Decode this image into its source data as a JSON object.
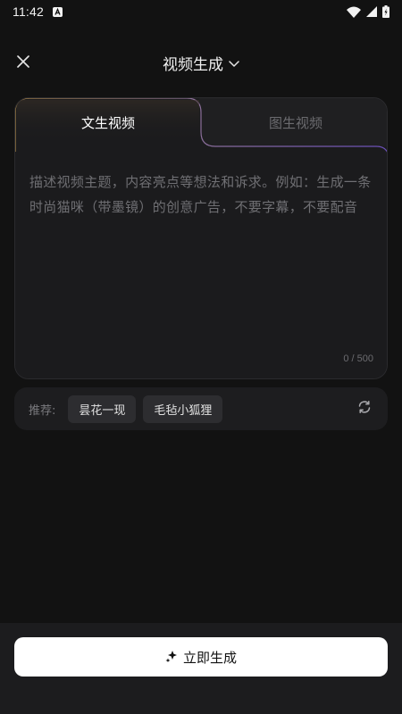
{
  "status_bar": {
    "time": "11:42",
    "icons": [
      "notification-a-icon",
      "wifi-icon",
      "signal-icon",
      "battery-charging-icon"
    ]
  },
  "header": {
    "title": "视频生成",
    "close_icon": "close-icon",
    "dropdown_icon": "chevron-down-icon"
  },
  "tabs": [
    {
      "label": "文生视频",
      "active": true
    },
    {
      "label": "图生视频",
      "active": false
    }
  ],
  "prompt": {
    "placeholder": "描述视频主题，内容亮点等想法和诉求。例如：生成一条时尚猫咪（带墨镜）的创意广告，不要字幕，不要配音",
    "counter": "0 / 500"
  },
  "recommend": {
    "label": "推荐:",
    "chips": [
      "昙花一现",
      "毛毡小狐狸"
    ],
    "refresh_icon": "refresh-icon"
  },
  "action": {
    "generate_label": "立即生成",
    "generate_icon": "sparkle-icon"
  },
  "colors": {
    "background": "#121212",
    "card": "#1b1b1d",
    "accent_gold": "#b08a4a",
    "accent_purple": "#6a4fb8",
    "button_bg": "#ffffff"
  }
}
